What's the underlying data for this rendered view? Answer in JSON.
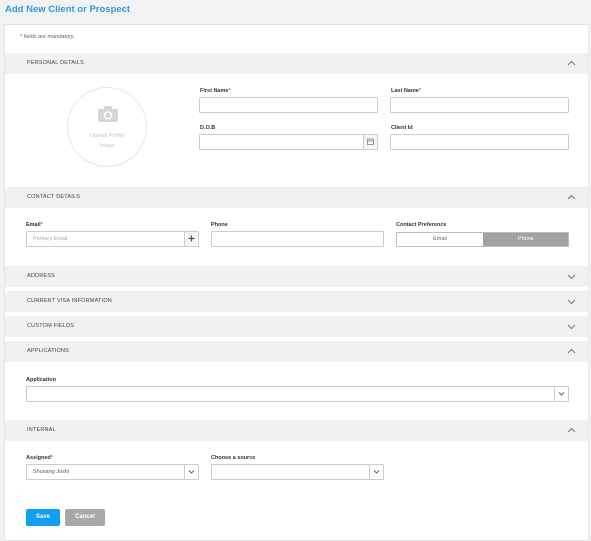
{
  "page": {
    "title": "Add New Client or Prospect"
  },
  "form": {
    "mandatory_note": "* fields are mandatory.",
    "sections": {
      "personal": "PERSONAL DETAILS",
      "contact": "CONTACT DETAILS",
      "address": "ADDRESS",
      "visa": "CURRENT VISA INFORMATION",
      "custom": "CUSTOM FIELDS",
      "applications": "APPLICATIONS",
      "internal": "INTERNAL"
    },
    "personal": {
      "upload_label": "Upload Profile\nImage",
      "first_name_label": "First Name",
      "last_name_label": "Last Name",
      "dob_label": "D.O.B",
      "client_id_label": "Client Id",
      "required_mark": "*"
    },
    "contact": {
      "email_label": "Email",
      "email_placeholder": "Primary Email",
      "phone_label": "Phone",
      "preference_label": "Contact Preference",
      "preference_options": [
        "Email",
        "Phone"
      ],
      "preference_selected": "Phone"
    },
    "applications": {
      "application_label": "Application"
    },
    "internal": {
      "assigned_label": "Assigned",
      "assigned_value": "Shuvang Joshi",
      "source_label": "Choose a source"
    },
    "buttons": {
      "save": "Save",
      "cancel": "Cancel"
    }
  }
}
